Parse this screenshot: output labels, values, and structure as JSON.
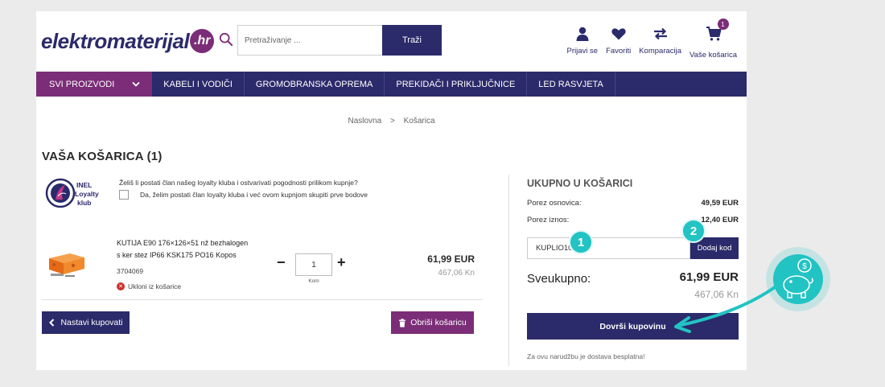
{
  "header": {
    "logo_text": "elektromaterijal",
    "logo_suffix": ".hr",
    "search_placeholder": "Pretraživanje ...",
    "search_button": "Traži",
    "icons": [
      {
        "label": "Prijavi se",
        "icon": "user-icon"
      },
      {
        "label": "Favoriti",
        "icon": "heart-icon"
      },
      {
        "label": "Komparacija",
        "icon": "compare-arrows-icon"
      },
      {
        "label": "Vaše košarica",
        "icon": "cart-icon"
      }
    ],
    "cart_count": "1"
  },
  "nav": {
    "items": [
      "SVI PROIZVODI",
      "KABELI I VODIČI",
      "GROMOBRANSKA OPREMA",
      "PREKIDAČI I PRIKLJUČNICE",
      "LED RASVJETA"
    ]
  },
  "breadcrumb": {
    "home": "Naslovna",
    "separator": ">",
    "current": "Košarica"
  },
  "cart": {
    "title": "VAŠA KOŠARICA (1)",
    "loyalty": {
      "logo_line1": "INEL",
      "logo_line2": "Loyalty",
      "logo_line3": "klub",
      "question": "Želiš li postati član našeg loyalty kluba i ostvarivati pogodnosti prilikom kupnje?",
      "checkbox_label": "Da, želim postati član loyalty kluba i već ovom kupnjom skupiti prve bodove"
    },
    "item": {
      "name": "KUTIJA E90 176×126×51 nž bezhalogen s ker stez IP66 KSK175 PO16 Kopos",
      "sku": "3704069",
      "remove": "Ukloni iz košarice",
      "qty": "1",
      "qty_unit": "Kom",
      "price_eur": "61,99 EUR",
      "price_kn": "467,06 Kn"
    },
    "continue_button": "Nastavi kupovati",
    "clear_button": "Obriši košaricu"
  },
  "summary": {
    "title": "UKUPNO U KOŠARICI",
    "tax_base_label": "Porez osnovica:",
    "tax_base_value": "49,59 EUR",
    "tax_label": "Porez iznos:",
    "tax_value": "12,40 EUR",
    "coupon_value": "KUPLIO10",
    "coupon_button": "Dodaj kod",
    "total_label": "Sveukupno:",
    "total_eur": "61,99 EUR",
    "total_kn": "467,06 Kn",
    "checkout_button": "Dovrši kupovinu",
    "free_shipping": "Za ovu narudžbu je dostava besplatna!"
  },
  "annotations": {
    "marker1": "1",
    "marker2": "2"
  },
  "colors": {
    "primary": "#2b2a6b",
    "accent": "#7b2d77",
    "highlight": "#22c3c3"
  }
}
